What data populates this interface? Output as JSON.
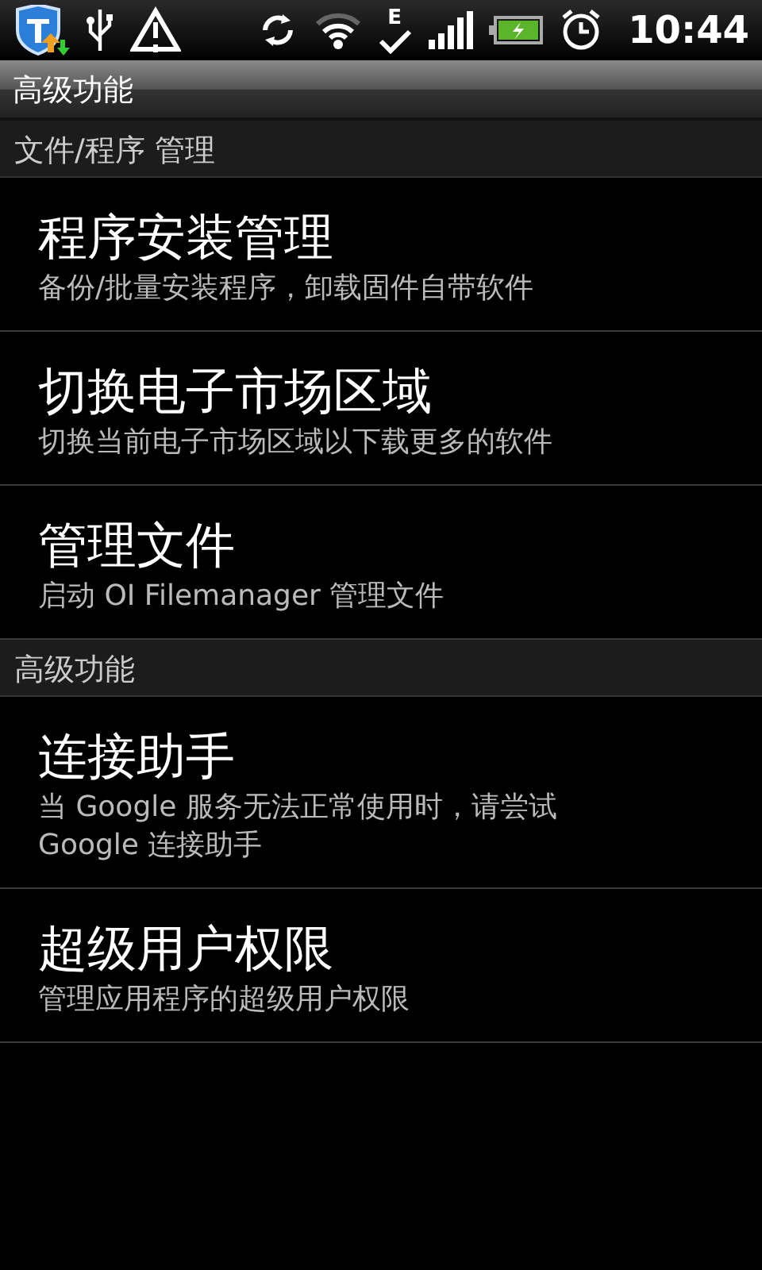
{
  "status_bar": {
    "network_type": "E",
    "time": "10:44"
  },
  "title_bar": {
    "title": "高级功能"
  },
  "sections": [
    {
      "header": "文件/程序 管理",
      "items": [
        {
          "title": "程序安装管理",
          "subtitle": "备份/批量安装程序，卸载固件自带软件"
        },
        {
          "title": "切换电子市场区域",
          "subtitle": "切换当前电子市场区域以下载更多的软件"
        },
        {
          "title": "管理文件",
          "subtitle": "启动 OI Filemanager 管理文件"
        }
      ]
    },
    {
      "header": "高级功能",
      "items": [
        {
          "title": "连接助手",
          "subtitle": "当 Google 服务无法正常使用时，请尝试 Google 连接助手"
        },
        {
          "title": "超级用户权限",
          "subtitle": "管理应用程序的超级用户权限"
        }
      ]
    }
  ]
}
